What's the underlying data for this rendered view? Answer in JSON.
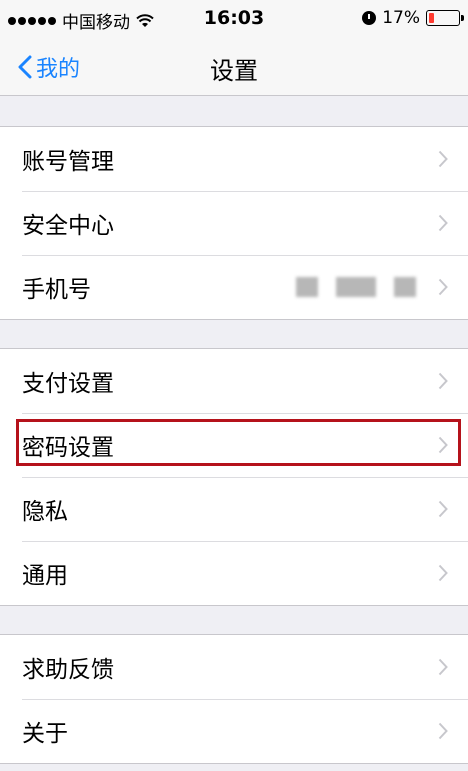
{
  "status_bar": {
    "carrier": "中国移动",
    "time": "16:03",
    "battery_percent": "17%",
    "battery_level": 0.17
  },
  "nav": {
    "back_label": "我的",
    "title": "设置"
  },
  "groups": [
    {
      "items": [
        {
          "label": "账号管理"
        },
        {
          "label": "安全中心"
        },
        {
          "label": "手机号"
        }
      ]
    },
    {
      "items": [
        {
          "label": "支付设置"
        },
        {
          "label": "密码设置"
        },
        {
          "label": "隐私"
        },
        {
          "label": "通用"
        }
      ]
    },
    {
      "items": [
        {
          "label": "求助反馈"
        },
        {
          "label": "关于"
        }
      ]
    }
  ],
  "colors": {
    "accent": "#1a84ff",
    "highlight_border": "#b5121b",
    "battery_low": "#ff3b30"
  }
}
